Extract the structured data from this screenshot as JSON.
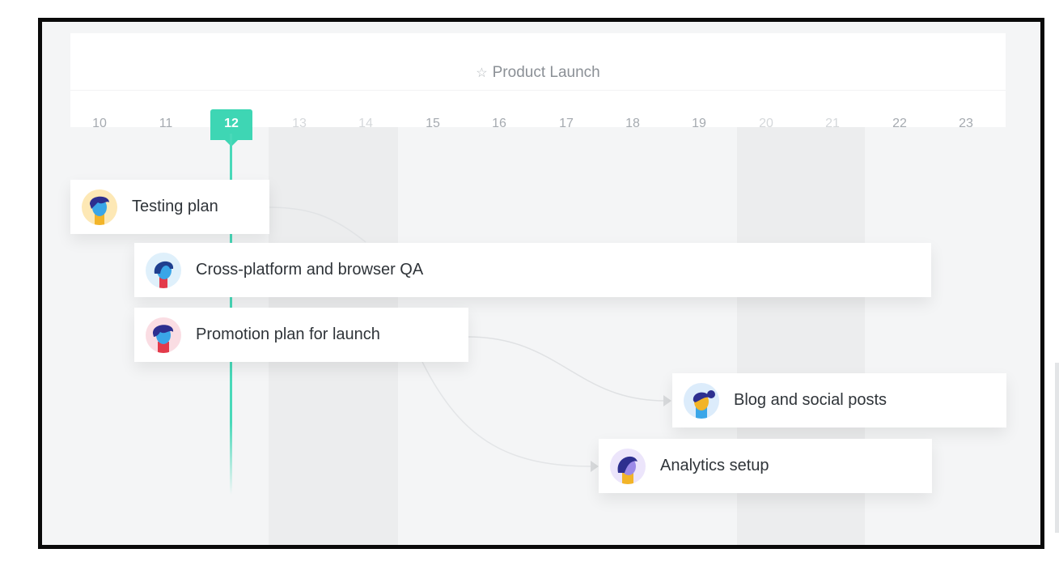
{
  "timeline": {
    "title": "Product Launch",
    "title_icon": "star-outline-icon",
    "days": [
      "10",
      "11",
      "12",
      "13",
      "14",
      "15",
      "16",
      "17",
      "18",
      "19",
      "20",
      "21",
      "22",
      "23"
    ],
    "today": "12",
    "accent_color": "#3ed6b4"
  },
  "tasks": [
    {
      "label": "Testing plan",
      "avatar": "person-avatar-curly-hair"
    },
    {
      "label": "Cross-platform and browser QA",
      "avatar": "person-avatar-bob-hair"
    },
    {
      "label": "Promotion plan for launch",
      "avatar": "person-avatar-curly-red"
    },
    {
      "label": "Blog and social posts",
      "avatar": "person-avatar-bun-hair"
    },
    {
      "label": "Analytics setup",
      "avatar": "person-avatar-purple"
    }
  ]
}
